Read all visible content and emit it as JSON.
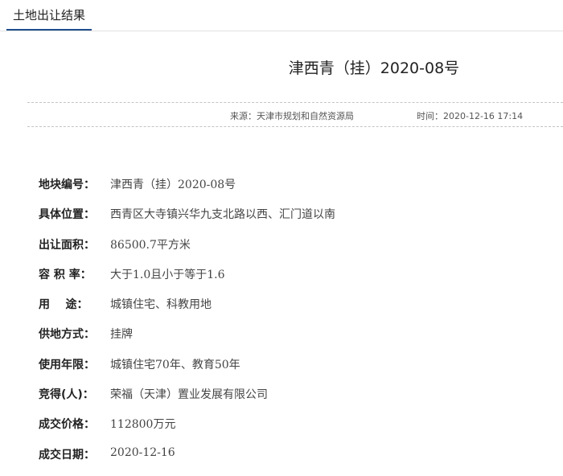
{
  "tab": {
    "label": "土地出让结果"
  },
  "article": {
    "title": "津西青（挂）2020-08号",
    "source": "来源：天津市规划和自然资源局",
    "time": "时间：2020-12-16 17:14"
  },
  "fields": [
    {
      "label": "地块编号：",
      "value": "津西青（挂）2020-08号"
    },
    {
      "label": "具体位置：",
      "value": "西青区大寺镇兴华九支北路以西、汇门道以南"
    },
    {
      "label": "出让面积：",
      "value": "86500.7平方米"
    },
    {
      "label": "容 积 率：",
      "value": "大于1.0且小于等于1.6"
    },
    {
      "label": "用    途：",
      "value": "城镇住宅、科教用地"
    },
    {
      "label": "供地方式：",
      "value": "挂牌"
    },
    {
      "label": "使用年限：",
      "value": "城镇住宅70年、教育50年"
    },
    {
      "label": "竞得(人)：",
      "value": "荣福（天津）置业发展有限公司"
    },
    {
      "label": "成交价格：",
      "value": "112800万元"
    },
    {
      "label": "成交日期：",
      "value": "2020-12-16"
    }
  ]
}
